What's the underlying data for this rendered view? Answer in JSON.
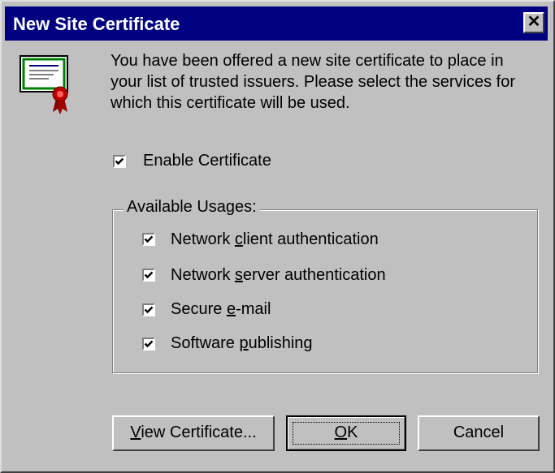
{
  "window": {
    "title": "New Site Certificate",
    "close_glyph": "✕"
  },
  "message": "You have been offered a new site certificate to place in your list of trusted issuers. Please select the services for which this certificate will be used.",
  "enable": {
    "label": "Enable Certificate",
    "checked": true
  },
  "usages": {
    "group_label": "Available Usages:",
    "items": [
      {
        "pre": "Network ",
        "accel": "c",
        "post": "lient authentication",
        "checked": true
      },
      {
        "pre": "Network ",
        "accel": "s",
        "post": "erver authentication",
        "checked": true
      },
      {
        "pre": "Secure ",
        "accel": "e",
        "post": "-mail",
        "checked": true
      },
      {
        "pre": "Software ",
        "accel": "p",
        "post": "ublishing",
        "checked": true
      }
    ]
  },
  "buttons": {
    "view": {
      "accel": "V",
      "rest": "iew Certificate..."
    },
    "ok": {
      "accel": "O",
      "rest": "K"
    },
    "cancel": "Cancel"
  },
  "icons": {
    "certificate": "certificate-icon",
    "check": "checkmark-icon"
  },
  "colors": {
    "title_bar": "#000080",
    "face": "#c0c0c0",
    "cert_border": "#008000",
    "seal": "#c00000"
  }
}
